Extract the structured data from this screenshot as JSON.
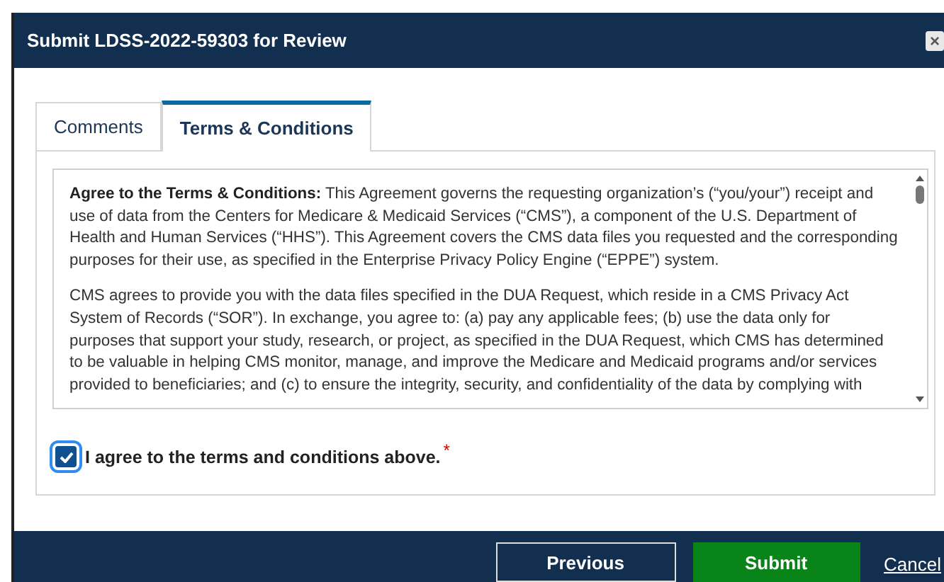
{
  "dialog": {
    "title": "Submit LDSS-2022-59303 for Review",
    "close": "×"
  },
  "tabs": [
    {
      "label": "Comments",
      "selected": false
    },
    {
      "label": "Terms & Conditions",
      "selected": true
    }
  ],
  "terms": {
    "paragraphs": [
      "**Agree to the Terms & Conditions:** This Agreement governs the requesting organization’s (“you/your”) receipt and use of data from the Centers for Medicare & Medicaid Services (“CMS”), a component of the U.S. Department of Health and Human Services (“HHS”). This Agreement covers the CMS data files you requested and the corresponding purposes for their use, as specified in the Enterprise Privacy Policy Engine (“EPPE”) system.",
      "CMS agrees to provide you with the data files specified in the DUA Request, which reside in a CMS Privacy Act System of Records (“SOR”). In exchange, you agree to: (a) pay any applicable fees; (b) use the data only for purposes that support your study, research, or project, as specified in the DUA Request, which CMS has determined to be valuable in helping CMS monitor, manage, and improve the Medicare and Medicaid programs and/or services provided to beneficiaries; and (c) to ensure the integrity, security, and confidentiality of the data by complying with"
    ]
  },
  "agreement": {
    "label": "I agree to the terms and conditions above.",
    "required_mark": "*",
    "checked": true
  },
  "buttons": [
    {
      "label": "Previous",
      "kind": "secondary"
    },
    {
      "label": "Submit",
      "kind": "primary"
    },
    {
      "label": "Cancel",
      "kind": "link"
    }
  ]
}
